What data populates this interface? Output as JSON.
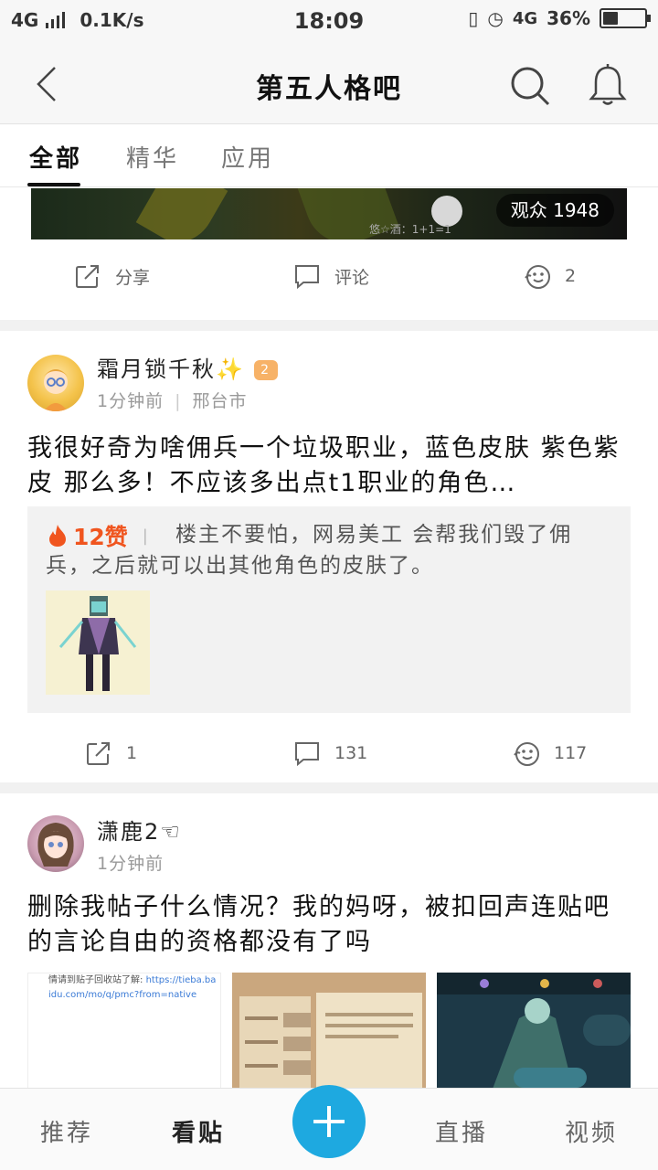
{
  "status_bar": {
    "network": "4G",
    "speed": "0.1K/s",
    "time": "18:09",
    "network_right": "4G",
    "battery": "36%",
    "battery_level": 0.36
  },
  "header": {
    "title": "第五人格吧"
  },
  "tabs": [
    {
      "label": "全部",
      "active": true
    },
    {
      "label": "精华",
      "active": false
    },
    {
      "label": "应用",
      "active": false
    }
  ],
  "live_card": {
    "viewers": "观众 1948",
    "danmaku": "悠☆酒：1+1=1",
    "actions": {
      "share_label": "分享",
      "comment_label": "评论",
      "like_count": "2"
    }
  },
  "posts": [
    {
      "author": "霜月锁千秋",
      "badge": "✨",
      "time": "1分钟前",
      "location": "邢台市",
      "title": "我很好奇为啥佣兵一个垃圾职业，蓝色皮肤 紫色紫皮 那么多！不应该多出点t1职业的角色…",
      "top_comment": {
        "likes": "12赞",
        "text": "楼主不要怕，网易美工 会帮我们毁了佣兵，之后就可以出其他角色的皮肤了。"
      },
      "actions": {
        "share_count": "1",
        "comment_count": "131",
        "like_count": "117"
      }
    },
    {
      "author": "潇鹿2",
      "badge": "☜",
      "time": "1分钟前",
      "title": "删除我帖子什么情况？我的妈呀，被扣回声连贴吧的言论自由的资格都没有了吗",
      "image1_text": "情请到贴子回收站了解: ",
      "image1_link": "https://tieba.baidu.com/mo/q/pmc?from=native"
    }
  ],
  "bottom_nav": {
    "items": [
      "推荐",
      "看贴",
      "直播",
      "视频"
    ],
    "active": "看贴"
  },
  "colors": {
    "accent": "#1ea9e0",
    "like_orange": "#f0551f"
  }
}
